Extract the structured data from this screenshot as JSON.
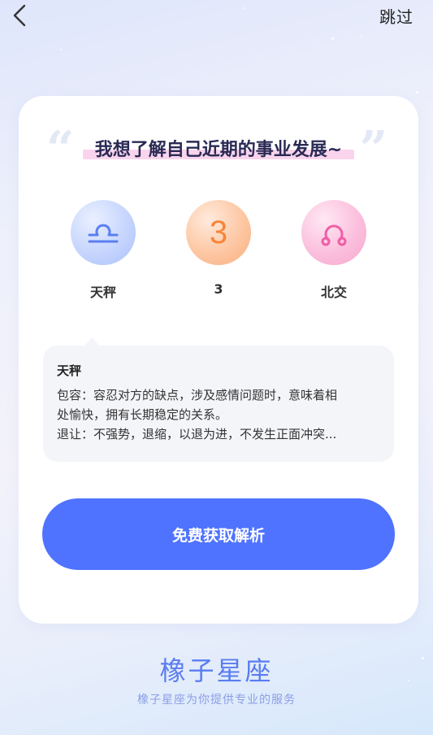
{
  "header": {
    "skip_label": "跳过"
  },
  "question": "我想了解自己近期的事业发展~",
  "astro_items": [
    {
      "label": "天秤",
      "icon": "libra-icon",
      "color": "#a9c1fb"
    },
    {
      "label": "3",
      "number": "3",
      "icon": "number-badge",
      "color": "#f5853a"
    },
    {
      "label": "北交",
      "icon": "north-node-icon",
      "color": "#f27ab5"
    }
  ],
  "description": {
    "title": "天秤",
    "lines": [
      "包容：容忍对方的缺点，涉及感情问题时，意味着相",
      "处愉快，拥有长期稳定的关系。",
      "退让：不强势，退缩，以退为进，不发生正面冲突..."
    ]
  },
  "cta_label": "免费获取解析",
  "brand": {
    "name": "橡子星座",
    "tagline": "橡子星座为你提供专业的服务"
  },
  "colors": {
    "accent": "#4f73ff",
    "brand": "#5a7cf0"
  }
}
